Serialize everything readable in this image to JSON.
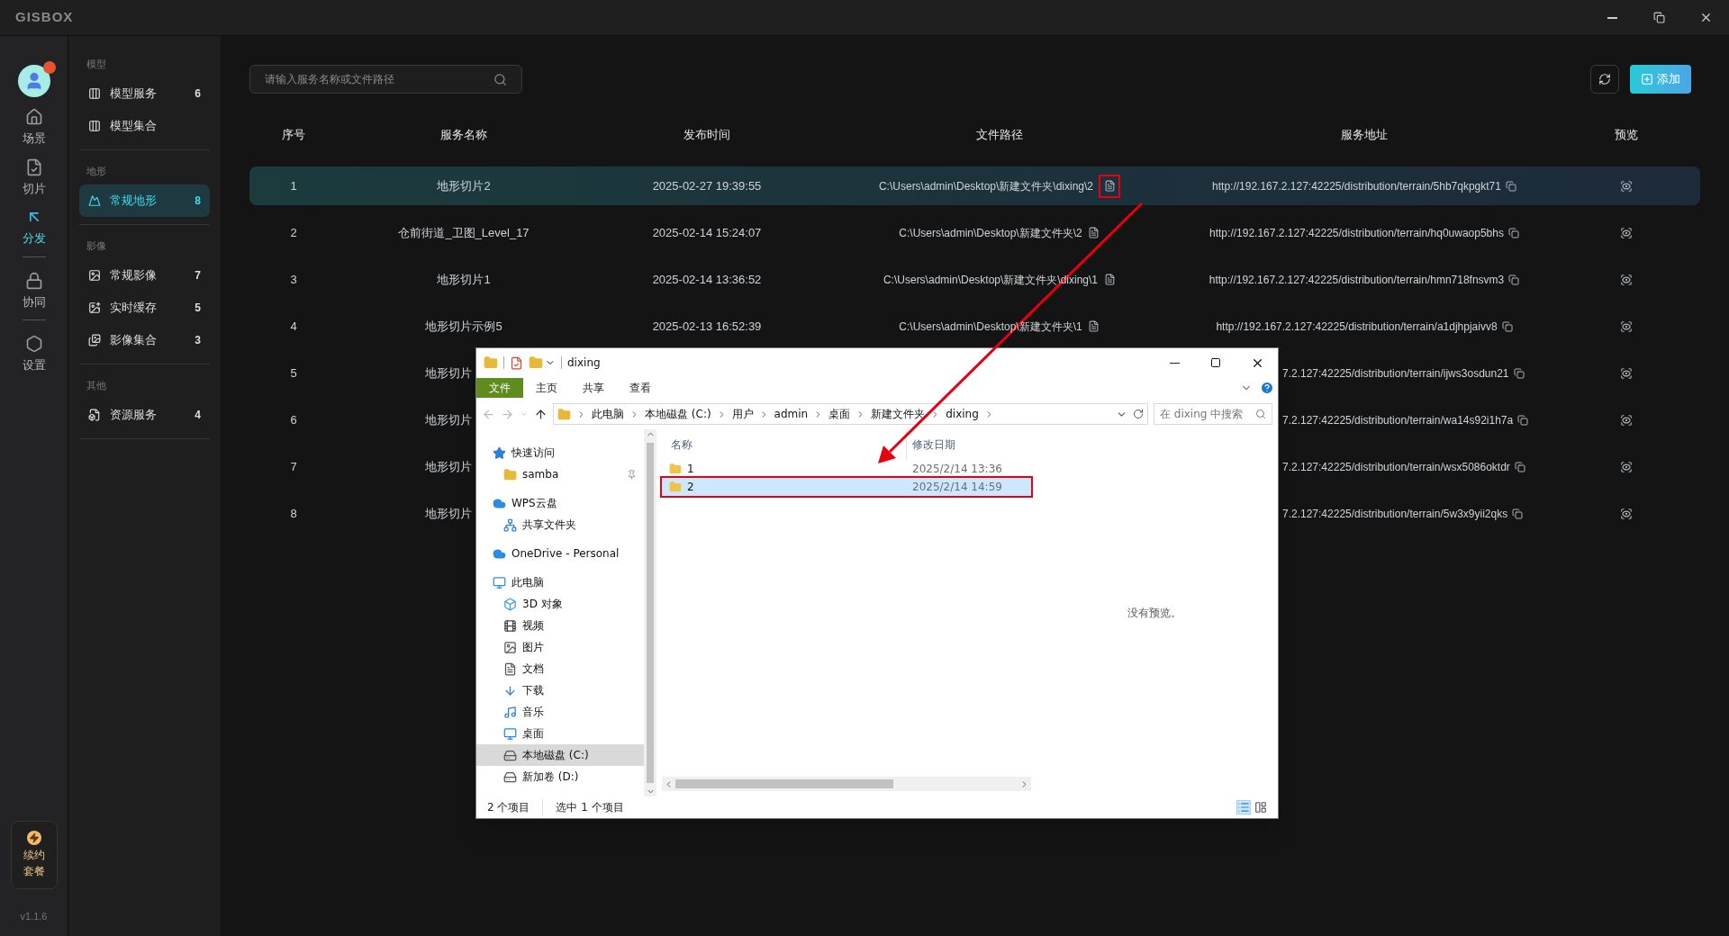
{
  "app": {
    "logo": "GISBOX",
    "version": "v1.1.6",
    "renew_lines": [
      "续约",
      "套餐"
    ]
  },
  "rail": [
    {
      "label": "场景",
      "selected": false,
      "divider_before": false
    },
    {
      "label": "切片",
      "selected": false,
      "divider_before": false
    },
    {
      "label": "分发",
      "selected": true,
      "divider_before": false
    },
    {
      "label": "协同",
      "selected": false,
      "divider_before": true
    },
    {
      "label": "设置",
      "selected": false,
      "divider_before": true
    }
  ],
  "nav": [
    {
      "title": "模型",
      "items": [
        {
          "label": "模型服务",
          "count": "6",
          "selected": false
        },
        {
          "label": "模型集合",
          "selected": false
        }
      ]
    },
    {
      "title": "地形",
      "items": [
        {
          "label": "常规地形",
          "count": "8",
          "selected": true
        }
      ]
    },
    {
      "title": "影像",
      "items": [
        {
          "label": "常规影像",
          "count": "7",
          "selected": false
        },
        {
          "label": "实时缓存",
          "count": "5",
          "selected": false
        },
        {
          "label": "影像集合",
          "count": "3",
          "selected": false
        }
      ]
    },
    {
      "title": "其他",
      "items": [
        {
          "label": "资源服务",
          "count": "4",
          "selected": false
        }
      ]
    }
  ],
  "search": {
    "placeholder": "请输入服务名称或文件路径"
  },
  "toolbar": {
    "add_label": "添加"
  },
  "table": {
    "columns": [
      "序号",
      "服务名称",
      "发布时间",
      "文件路径",
      "服务地址",
      "预览"
    ],
    "rows": [
      {
        "kind": "full",
        "index": "1",
        "name": "地形切片2",
        "time": "2025-02-27 19:39:55",
        "path": "C:\\Users\\admin\\Desktop\\新建文件夹\\dixing\\2",
        "url": "http://192.167.2.127:42225/distribution/terrain/5hb7qkpgkt71",
        "selected": true,
        "path_icon_highlighted": true
      },
      {
        "kind": "full",
        "index": "2",
        "name": "仓前街道_卫图_Level_17",
        "time": "2025-02-14 15:24:07",
        "path": "C:\\Users\\admin\\Desktop\\新建文件夹\\2",
        "url": "http://192.167.2.127:42225/distribution/terrain/hq0uwaop5bhs",
        "selected": false,
        "path_icon_highlighted": false
      },
      {
        "kind": "full",
        "index": "3",
        "name": "地形切片1",
        "time": "2025-02-14 13:36:52",
        "path": "C:\\Users\\admin\\Desktop\\新建文件夹\\dixing\\1",
        "url": "http://192.167.2.127:42225/distribution/terrain/hmn718fnsvm3",
        "selected": false,
        "path_icon_highlighted": false
      },
      {
        "kind": "full",
        "index": "4",
        "name": "地形切片示例5",
        "time": "2025-02-13 16:52:39",
        "path": "C:\\Users\\admin\\Desktop\\新建文件夹\\1",
        "url": "http://192.167.2.127:42225/distribution/terrain/a1djhpjaivv8",
        "selected": false,
        "path_icon_highlighted": false
      },
      {
        "kind": "partial",
        "index": "5",
        "name": "地形切片",
        "url": "7.2.127:42225/distribution/terrain/ijws3osdun21",
        "selected": false
      },
      {
        "kind": "partial",
        "index": "6",
        "name": "地形切片",
        "url": "7.2.127:42225/distribution/terrain/wa14s92i1h7a",
        "selected": false
      },
      {
        "kind": "partial",
        "index": "7",
        "name": "地形切片",
        "url": "7.2.127:42225/distribution/terrain/wsx5086oktdr",
        "selected": false
      },
      {
        "kind": "partial",
        "index": "8",
        "name": "地形切片",
        "url": "7.2.127:42225/distribution/terrain/5w3x9yii2qks",
        "selected": false
      }
    ]
  },
  "explorer": {
    "title": "dixing",
    "ribbon_tabs": [
      {
        "label": "文件",
        "selected": true
      },
      {
        "label": "主页",
        "selected": false
      },
      {
        "label": "共享",
        "selected": false
      },
      {
        "label": "查看",
        "selected": false
      }
    ],
    "breadcrumbs": [
      "此电脑",
      "本地磁盘 (C:)",
      "用户",
      "admin",
      "桌面",
      "新建文件夹",
      "dixing"
    ],
    "search": {
      "placeholder": "在 dixing 中搜索"
    },
    "nav": [
      {
        "kind": "quick",
        "label": "快速访问",
        "selected": false,
        "pinned": false,
        "children": [
          {
            "kind": "folder",
            "label": "samba",
            "selected": false,
            "pinned": true
          }
        ]
      },
      {
        "kind": "cloud",
        "label": "WPS云盘",
        "selected": false,
        "pinned": false,
        "children": [
          {
            "kind": "share",
            "label": "共享文件夹",
            "selected": false,
            "pinned": false
          }
        ]
      },
      {
        "kind": "cloud",
        "label": "OneDrive - Personal",
        "selected": false,
        "pinned": false
      },
      {
        "kind": "pc",
        "label": "此电脑",
        "selected": false,
        "pinned": false,
        "children": [
          {
            "kind": "object3d",
            "label": "3D 对象",
            "selected": false,
            "pinned": false
          },
          {
            "kind": "video",
            "label": "视频",
            "selected": false,
            "pinned": false
          },
          {
            "kind": "picture",
            "label": "图片",
            "selected": false,
            "pinned": false
          },
          {
            "kind": "doc",
            "label": "文档",
            "selected": false,
            "pinned": false
          },
          {
            "kind": "download",
            "label": "下载",
            "selected": false,
            "pinned": false
          },
          {
            "kind": "music",
            "label": "音乐",
            "selected": false,
            "pinned": false
          },
          {
            "kind": "desktop",
            "label": "桌面",
            "selected": false,
            "pinned": false
          },
          {
            "kind": "drive",
            "label": "本地磁盘 (C:)",
            "selected": true,
            "pinned": false
          },
          {
            "kind": "drive",
            "label": "新加卷 (D:)",
            "selected": false,
            "pinned": false
          }
        ]
      }
    ],
    "columns": [
      "名称",
      "修改日期"
    ],
    "files": [
      {
        "name": "1",
        "date": "2025/2/14 13:36",
        "selected": false,
        "highlighted": false
      },
      {
        "name": "2",
        "date": "2025/2/14 14:59",
        "selected": true,
        "highlighted": true
      }
    ],
    "preview_text": "没有预览。",
    "status": [
      "2 个项目",
      "选中 1 个项目"
    ]
  }
}
